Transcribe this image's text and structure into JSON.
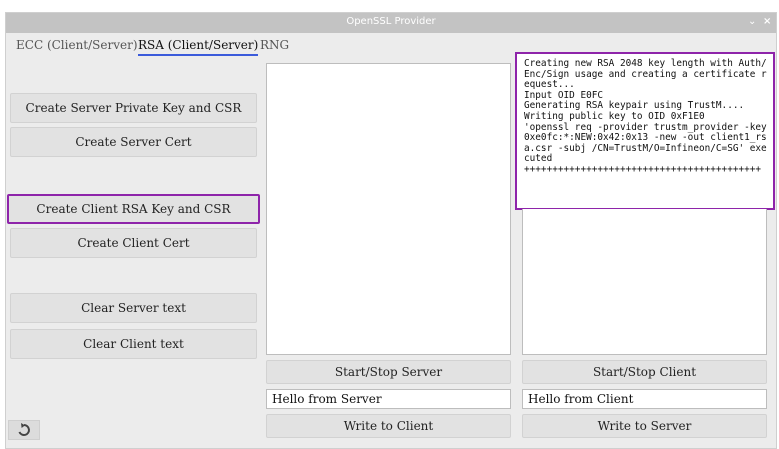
{
  "window": {
    "title": "OpenSSL Provider",
    "minimize_glyph": "⌄",
    "close_glyph": "×"
  },
  "tabs": [
    {
      "label": "ECC (Client/Server)",
      "active": false
    },
    {
      "label": "RSA (Client/Server)",
      "active": true
    },
    {
      "label": "RNG",
      "active": false
    }
  ],
  "left_buttons": {
    "create_server_key": "Create Server Private Key and CSR",
    "create_server_cert": "Create Server Cert",
    "create_client_key": "Create Client RSA Key and CSR",
    "create_client_cert": "Create Client Cert",
    "clear_server": "Clear Server text",
    "clear_client": "Clear Client text"
  },
  "server": {
    "log": "",
    "start_stop_label": "Start/Stop Server",
    "message_value": "Hello from Server",
    "write_label": "Write to Client"
  },
  "client": {
    "log": "Creating new RSA 2048 key length with Auth/Enc/Sign usage and creating a certificate request...\nInput OID E0FC\nGenerating RSA keypair using TrustM....\nWriting public key to OID 0xF1E0\n'openssl req -provider trustm_provider -key 0xe0fc:*:NEW:0x42:0x13 -new -out client1_rsa.csr -subj /CN=TrustM/O=Infineon/C=SG' executed\n++++++++++++++++++++++++++++++++++++++++++",
    "start_stop_label": "Start/Stop Client",
    "message_value": "Hello from Client",
    "write_label": "Write to Server"
  },
  "colors": {
    "selection_outline": "#8e24aa",
    "tab_underline": "#3b5bdb"
  }
}
